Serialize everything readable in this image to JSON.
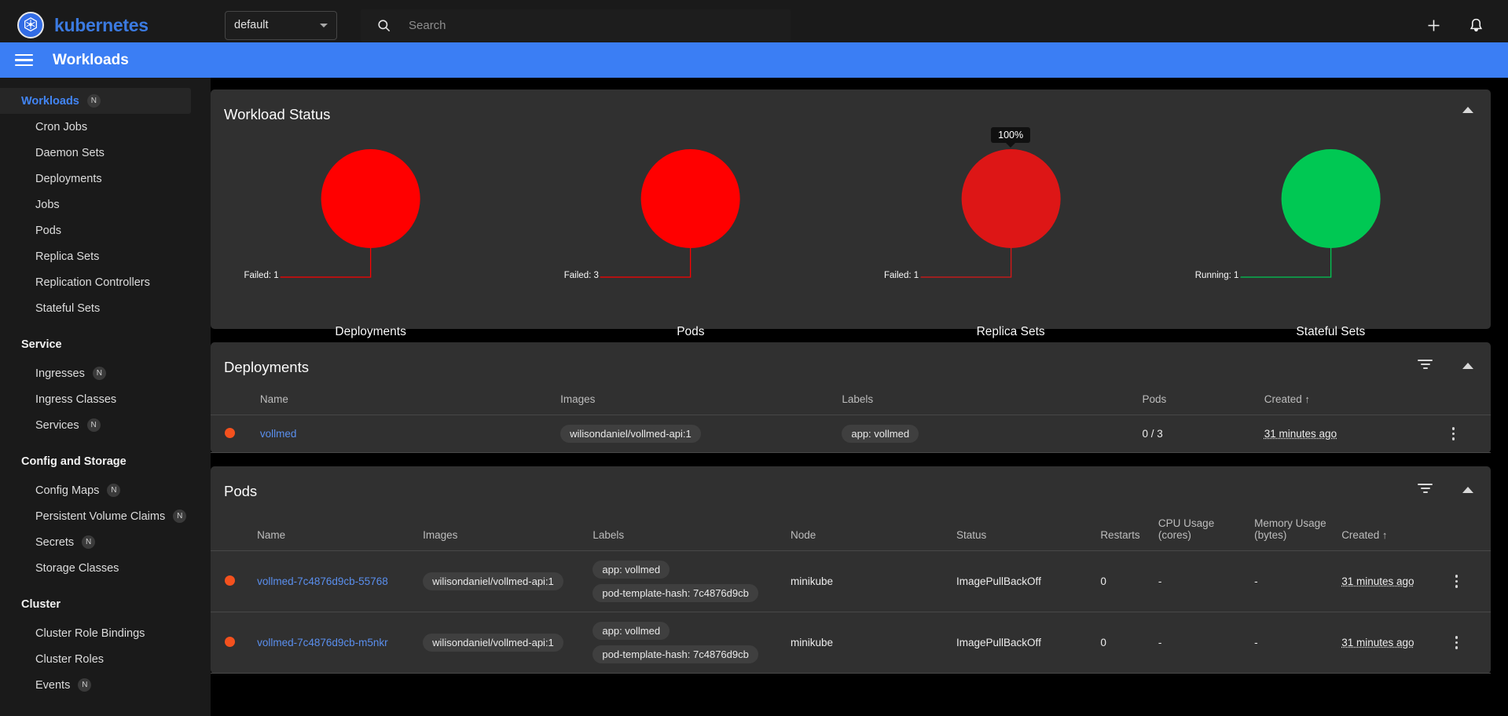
{
  "topbar": {
    "brand": "kubernetes",
    "logo_icon": "kubernetes-helm-icon",
    "namespace": {
      "value": "default",
      "caret_icon": "chevron-down-icon"
    },
    "search": {
      "placeholder": "Search",
      "value": "",
      "icon": "search-icon"
    },
    "add_icon": "plus-icon",
    "notifications_icon": "bell-icon"
  },
  "header": {
    "menu_icon": "hamburger-menu-icon",
    "title": "Workloads"
  },
  "sidebar": {
    "items": [
      {
        "label": "Workloads",
        "badge": "N",
        "active": true,
        "type": "item"
      },
      {
        "label": "Cron Jobs",
        "badge": "",
        "active": false,
        "type": "item"
      },
      {
        "label": "Daemon Sets",
        "badge": "",
        "active": false,
        "type": "item"
      },
      {
        "label": "Deployments",
        "badge": "",
        "active": false,
        "type": "item"
      },
      {
        "label": "Jobs",
        "badge": "",
        "active": false,
        "type": "item"
      },
      {
        "label": "Pods",
        "badge": "",
        "active": false,
        "type": "item"
      },
      {
        "label": "Replica Sets",
        "badge": "",
        "active": false,
        "type": "item"
      },
      {
        "label": "Replication Controllers",
        "badge": "",
        "active": false,
        "type": "item"
      },
      {
        "label": "Stateful Sets",
        "badge": "",
        "active": false,
        "type": "item"
      },
      {
        "label": "Service",
        "badge": "",
        "active": false,
        "type": "group"
      },
      {
        "label": "Ingresses",
        "badge": "N",
        "active": false,
        "type": "item"
      },
      {
        "label": "Ingress Classes",
        "badge": "",
        "active": false,
        "type": "item"
      },
      {
        "label": "Services",
        "badge": "N",
        "active": false,
        "type": "item"
      },
      {
        "label": "Config and Storage",
        "badge": "",
        "active": false,
        "type": "group"
      },
      {
        "label": "Config Maps",
        "badge": "N",
        "active": false,
        "type": "item"
      },
      {
        "label": "Persistent Volume Claims",
        "badge": "N",
        "active": false,
        "type": "item"
      },
      {
        "label": "Secrets",
        "badge": "N",
        "active": false,
        "type": "item"
      },
      {
        "label": "Storage Classes",
        "badge": "",
        "active": false,
        "type": "item"
      },
      {
        "label": "Cluster",
        "badge": "",
        "active": false,
        "type": "group"
      },
      {
        "label": "Cluster Role Bindings",
        "badge": "",
        "active": false,
        "type": "item"
      },
      {
        "label": "Cluster Roles",
        "badge": "",
        "active": false,
        "type": "item"
      },
      {
        "label": "Events",
        "badge": "N",
        "active": false,
        "type": "item"
      }
    ]
  },
  "workload_status": {
    "title": "Workload Status",
    "collapse_icon": "chevron-up-icon"
  },
  "chart_data": [
    {
      "type": "pie",
      "title": "Deployments",
      "slices": [
        {
          "label": "Failed",
          "value": 1,
          "percent": 100,
          "color": "#ff0000"
        }
      ],
      "leader_label": "Failed: 1",
      "tooltip": ""
    },
    {
      "type": "pie",
      "title": "Pods",
      "slices": [
        {
          "label": "Failed",
          "value": 3,
          "percent": 100,
          "color": "#ff0000"
        }
      ],
      "leader_label": "Failed: 3",
      "tooltip": ""
    },
    {
      "type": "pie",
      "title": "Replica Sets",
      "slices": [
        {
          "label": "Failed",
          "value": 1,
          "percent": 100,
          "color": "#dd1616"
        }
      ],
      "leader_label": "Failed: 1",
      "tooltip": "100%"
    },
    {
      "type": "pie",
      "title": "Stateful Sets",
      "slices": [
        {
          "label": "Running",
          "value": 1,
          "percent": 100,
          "color": "#00c853"
        }
      ],
      "leader_label": "Running: 1",
      "tooltip": ""
    }
  ],
  "deployments": {
    "title": "Deployments",
    "filter_icon": "filter-funnel-icon",
    "collapse_icon": "chevron-up-icon",
    "columns": [
      "Name",
      "Images",
      "Labels",
      "Pods",
      "Created"
    ],
    "sort_column": "Created",
    "sort_icon": "arrow-up-icon",
    "rows": [
      {
        "status_color": "#f4511e",
        "name": "vollmed",
        "images": "wilisondaniel/vollmed-api:1",
        "labels": [
          "app: vollmed"
        ],
        "pods": "0 / 3",
        "created": "31 minutes ago",
        "menu_icon": "kebab-menu-icon"
      }
    ]
  },
  "pods": {
    "title": "Pods",
    "filter_icon": "filter-funnel-icon",
    "collapse_icon": "chevron-up-icon",
    "columns": [
      "Name",
      "Images",
      "Labels",
      "Node",
      "Status",
      "Restarts",
      "CPU Usage (cores)",
      "Memory Usage (bytes)",
      "Created"
    ],
    "sort_column": "Created",
    "sort_icon": "arrow-up-icon",
    "rows": [
      {
        "status_color": "#f4511e",
        "name": "vollmed-7c4876d9cb-55768",
        "images": "wilisondaniel/vollmed-api:1",
        "labels": [
          "app: vollmed",
          "pod-template-hash: 7c4876d9cb"
        ],
        "node": "minikube",
        "status": "ImagePullBackOff",
        "restarts": "0",
        "cpu": "-",
        "memory": "-",
        "created": "31 minutes ago",
        "menu_icon": "kebab-menu-icon"
      },
      {
        "status_color": "#f4511e",
        "name": "vollmed-7c4876d9cb-m5nkr",
        "images": "wilisondaniel/vollmed-api:1",
        "labels": [
          "app: vollmed",
          "pod-template-hash: 7c4876d9cb"
        ],
        "node": "minikube",
        "status": "ImagePullBackOff",
        "restarts": "0",
        "cpu": "-",
        "memory": "-",
        "created": "31 minutes ago",
        "menu_icon": "kebab-menu-icon"
      }
    ]
  },
  "colors": {
    "accent": "#3b7ef4",
    "failed": "#ff0000",
    "running": "#00c853",
    "status_dot": "#f4511e",
    "card_bg": "#303030",
    "sidebar_bg": "#1a1a1a"
  }
}
